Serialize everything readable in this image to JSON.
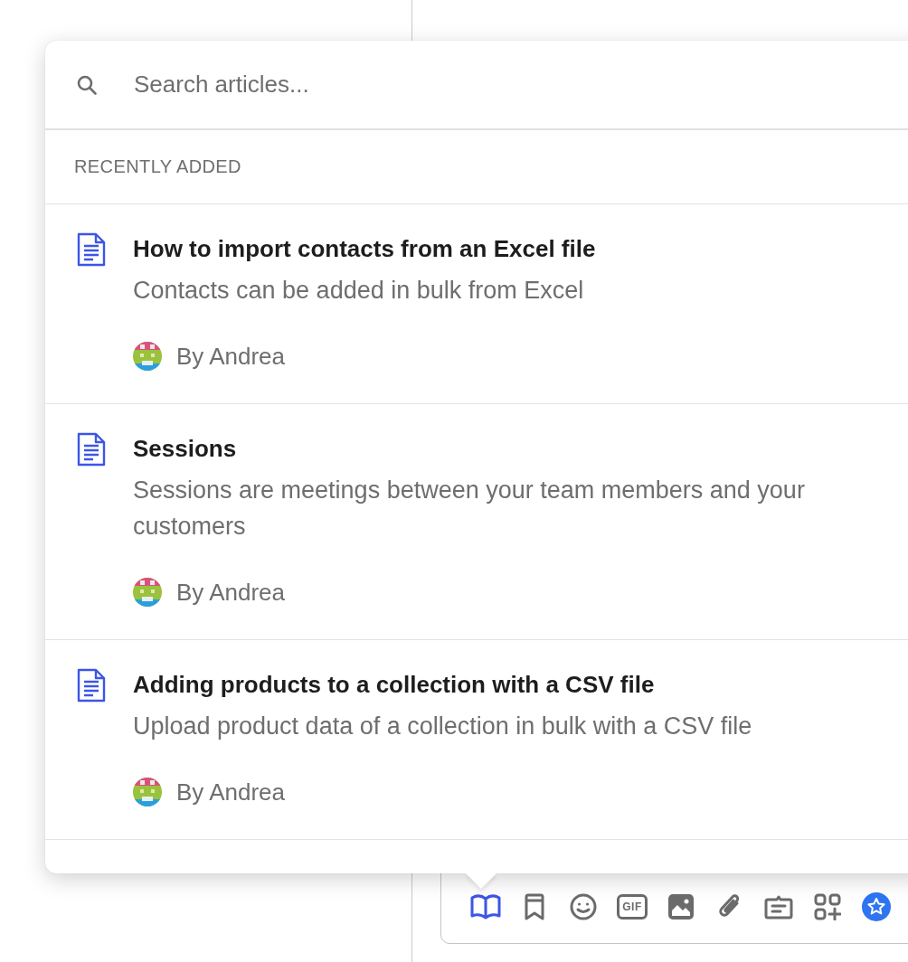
{
  "search": {
    "placeholder": "Search articles..."
  },
  "section_heading": "RECENTLY ADDED",
  "articles": [
    {
      "title": "How to import contacts from an Excel file",
      "summary": "Contacts can be added in bulk from Excel",
      "author": "By Andrea"
    },
    {
      "title": "Sessions",
      "summary": "Sessions are meetings between your team members and your customers",
      "author": "By Andrea"
    },
    {
      "title": "Adding products to a collection with a CSV file",
      "summary": "Upload product data of a collection in bulk with a CSV file",
      "author": "By Andrea"
    }
  ],
  "toolbar": [
    {
      "kind": "book",
      "selected": true
    },
    {
      "kind": "bookmark",
      "selected": false
    },
    {
      "kind": "emoji",
      "selected": false
    },
    {
      "kind": "gif",
      "label": "GIF",
      "selected": false
    },
    {
      "kind": "image",
      "selected": false
    },
    {
      "kind": "attachment",
      "selected": false
    },
    {
      "kind": "note",
      "selected": false
    },
    {
      "kind": "apps",
      "selected": false
    },
    {
      "kind": "star",
      "selected": false
    }
  ]
}
